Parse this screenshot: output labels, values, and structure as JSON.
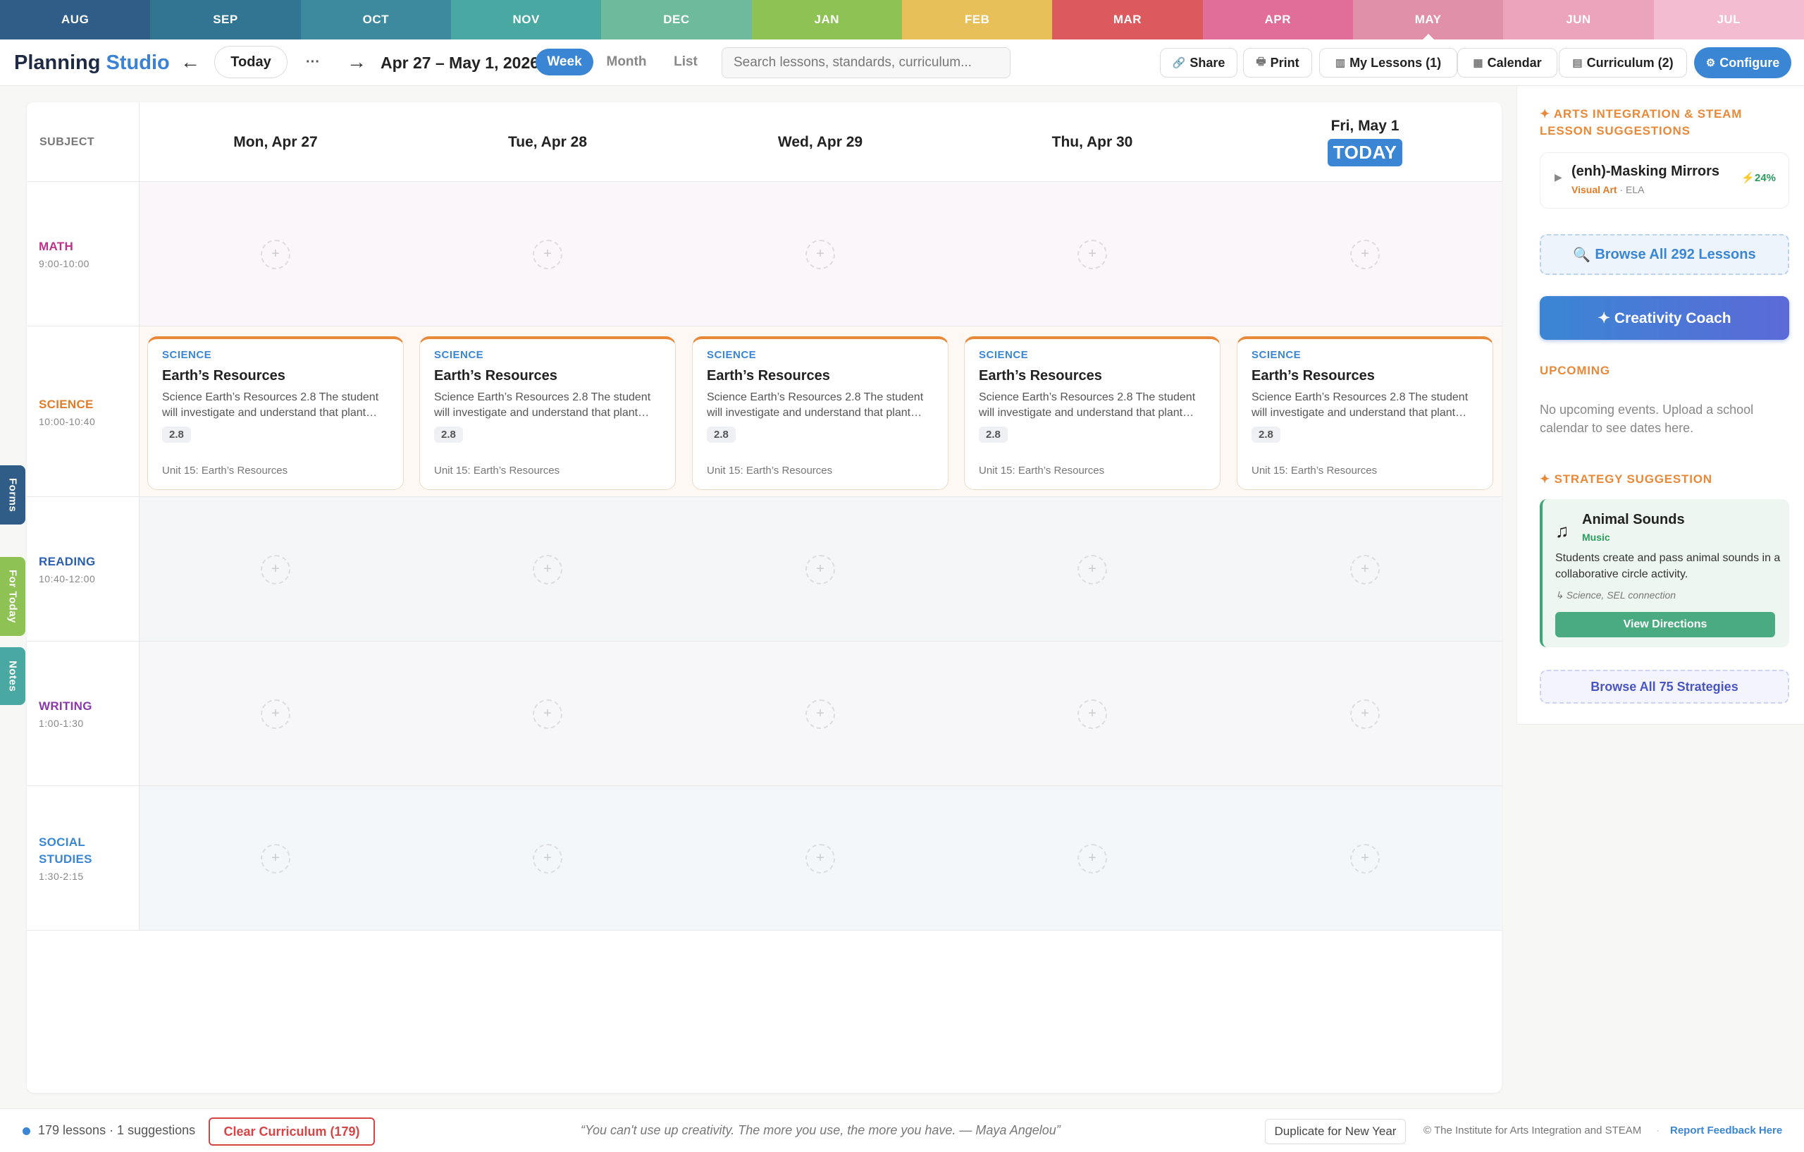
{
  "months": [
    {
      "label": "AUG",
      "color": "#2f5d87",
      "current": false
    },
    {
      "label": "SEP",
      "color": "#327593",
      "current": false
    },
    {
      "label": "OCT",
      "color": "#3d8a9e",
      "current": false
    },
    {
      "label": "NOV",
      "color": "#4aa8a2",
      "current": false
    },
    {
      "label": "DEC",
      "color": "#6dbb9c",
      "current": false
    },
    {
      "label": "JAN",
      "color": "#8fc254",
      "current": false
    },
    {
      "label": "FEB",
      "color": "#e8c05a",
      "current": false
    },
    {
      "label": "MAR",
      "color": "#dc5a5d",
      "current": false
    },
    {
      "label": "APR",
      "color": "#e06e98",
      "current": false
    },
    {
      "label": "MAY",
      "color": "#e190aa",
      "current": true
    },
    {
      "label": "JUN",
      "color": "#eba4bb",
      "current": false
    },
    {
      "label": "JUL",
      "color": "#f3bcd0",
      "current": false
    }
  ],
  "toolbar": {
    "brand_part1": "Planning",
    "brand_part2": "Studio",
    "prev": "←",
    "today": "Today",
    "more": "···",
    "next": "→",
    "date_range": "Apr 27 – May 1, 2026",
    "views": [
      "Week",
      "Month",
      "List"
    ],
    "active_view": "Week",
    "search_placeholder": "Search lessons, standards, curriculum...",
    "share": "Share",
    "print": "Print",
    "my_lessons": "My Lessons (1)",
    "calendar": "Calendar",
    "curriculum": "Curriculum (2)",
    "configure": "Configure"
  },
  "grid": {
    "subject_header": "SUBJECT",
    "days": [
      {
        "label": "Mon, Apr 27",
        "today": false
      },
      {
        "label": "Tue, Apr 28",
        "today": false
      },
      {
        "label": "Wed, Apr 29",
        "today": false
      },
      {
        "label": "Thu, Apr 30",
        "today": false
      },
      {
        "label": "Fri, May 1",
        "today": true
      }
    ],
    "today_badge": "TODAY",
    "rows": [
      {
        "name": "MATH",
        "time": "9:00-10:00",
        "color": "#c0308a",
        "bg": "#fbf6f9"
      },
      {
        "name": "SCIENCE",
        "time": "10:00-10:40",
        "color": "#e07b2a",
        "bg": "#fdf8f3"
      },
      {
        "name": "READING",
        "time": "10:40-12:00",
        "color": "#2a5fb0",
        "bg": "#f5f6f8"
      },
      {
        "name": "WRITING",
        "time": "1:00-1:30",
        "color": "#8a3aa8",
        "bg": "#f7f6f8"
      },
      {
        "name": "SOCIAL STUDIES",
        "time": "1:30-2:15",
        "color": "#3a86d4",
        "bg": "#f3f7fa"
      }
    ],
    "science_card": {
      "subject": "SCIENCE",
      "title": "Earth’s Resources",
      "description": "Science Earth’s Resources 2.8 The student will investigate and understand that plant…",
      "standard": "2.8",
      "unit": "Unit 15: Earth’s Resources"
    },
    "add_icon": "+"
  },
  "sidebar": {
    "arts_heading": "✦ ARTS INTEGRATION & STEAM LESSON SUGGESTIONS",
    "suggestion": {
      "title": "(enh)-Masking Mirrors",
      "art": "Visual Art",
      "subject": "· ELA",
      "match": "⚡24%"
    },
    "browse_lessons": "Browse All 292 Lessons",
    "coach": "✦ Creativity Coach",
    "upcoming_heading": "UPCOMING",
    "upcoming_text": "No upcoming events. Upload a school calendar to see dates here.",
    "strategy_heading": "✦ STRATEGY SUGGESTION",
    "strategy": {
      "title": "Animal Sounds",
      "category": "Music",
      "description": "Students create and pass animal sounds in a collaborative circle activity.",
      "connection": "↳ Science, SEL connection",
      "button": "View Directions"
    },
    "browse_strategies": "Browse All 75 Strategies"
  },
  "side_tabs": [
    {
      "label": "Forms",
      "color": "#2f5d87"
    },
    {
      "label": "For Today",
      "color": "#8fc254"
    },
    {
      "label": "Notes",
      "color": "#4aa8a2"
    }
  ],
  "footer": {
    "count": "179 lessons · 1 suggestions",
    "clear": "Clear Curriculum (179)",
    "quote": "“You can't use up creativity. The more you use, the more you have. — Maya Angelou”",
    "duplicate": "Duplicate for New Year",
    "copyright": "© The Institute for Arts Integration and STEAM",
    "separator": "·",
    "report": "Report Feedback Here"
  }
}
